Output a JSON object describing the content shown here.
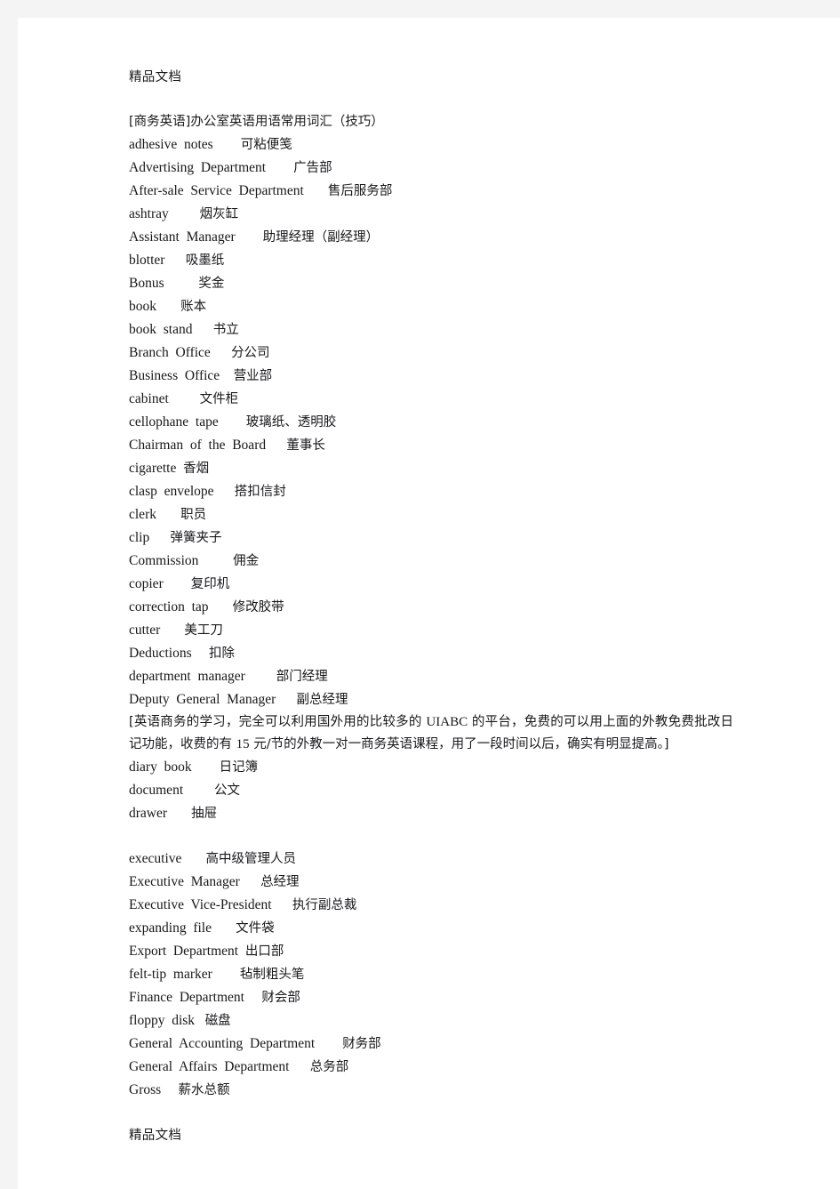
{
  "page": {
    "header_text": "精品文档",
    "footer_text": "精品文档",
    "title": "[商务英语]办公室英语用语常用词汇（技巧）",
    "background_color": "#f4f4f4",
    "paper_color": "#ffffff",
    "text_color": "#18181c"
  },
  "glossary": [
    {
      "en": "adhesive  notes",
      "gap": "        ",
      "cn": "可粘便笺"
    },
    {
      "en": "Advertising  Department",
      "gap": "        ",
      "cn": "广告部"
    },
    {
      "en": "After-sale  Service  Department",
      "gap": "       ",
      "cn": "售后服务部"
    },
    {
      "en": "ashtray",
      "gap": "         ",
      "cn": "烟灰缸"
    },
    {
      "en": "Assistant  Manager",
      "gap": "        ",
      "cn": "助理经理（副经理）"
    },
    {
      "en": "blotter",
      "gap": "      ",
      "cn": "吸墨纸"
    },
    {
      "en": "Bonus",
      "gap": "          ",
      "cn": "奖金"
    },
    {
      "en": "book",
      "gap": "       ",
      "cn": "账本"
    },
    {
      "en": "book  stand",
      "gap": "      ",
      "cn": "书立"
    },
    {
      "en": "Branch  Office",
      "gap": "      ",
      "cn": "分公司"
    },
    {
      "en": "Business  Office",
      "gap": "    ",
      "cn": "营业部"
    },
    {
      "en": "cabinet",
      "gap": "         ",
      "cn": "文件柜"
    },
    {
      "en": "cellophane  tape",
      "gap": "        ",
      "cn": "玻璃纸、透明胶"
    },
    {
      "en": "Chairman  of  the  Board",
      "gap": "      ",
      "cn": "董事长"
    },
    {
      "en": "cigarette",
      "gap": "  ",
      "cn": "香烟"
    },
    {
      "en": "clasp  envelope",
      "gap": "      ",
      "cn": "搭扣信封"
    },
    {
      "en": "clerk",
      "gap": "       ",
      "cn": "职员"
    },
    {
      "en": "clip",
      "gap": "      ",
      "cn": "弹簧夹子"
    },
    {
      "en": "Commission",
      "gap": "          ",
      "cn": "佣金"
    },
    {
      "en": "copier",
      "gap": "        ",
      "cn": "复印机"
    },
    {
      "en": "correction  tap",
      "gap": "       ",
      "cn": "修改胶带"
    },
    {
      "en": "cutter",
      "gap": "       ",
      "cn": "美工刀"
    },
    {
      "en": "Deductions",
      "gap": "     ",
      "cn": "扣除"
    },
    {
      "en": "department  manager",
      "gap": "         ",
      "cn": "部门经理"
    },
    {
      "en": "Deputy  General  Manager",
      "gap": "      ",
      "cn": "副总经理"
    }
  ],
  "note": {
    "prefix": "[英语商务的学习，完全可以利用国外用的比较多的 ",
    "brand": "UIABC",
    "middle": "  的平台，免费的可以用上面的外教免费批改日记功能，收费的有 ",
    "price": "15",
    "suffix": " 元/节的外教一对一商务英语课程，用了一段时间以后，确实有明显提高。]"
  },
  "glossary2": [
    {
      "en": "diary  book",
      "gap": "        ",
      "cn": "日记簿"
    },
    {
      "en": "document",
      "gap": "         ",
      "cn": "公文"
    },
    {
      "en": "drawer",
      "gap": "       ",
      "cn": "抽屉"
    }
  ],
  "glossary3": [
    {
      "en": "executive",
      "gap": "       ",
      "cn": "高中级管理人员"
    },
    {
      "en": "Executive  Manager",
      "gap": "      ",
      "cn": "总经理"
    },
    {
      "en": "Executive  Vice-President",
      "gap": "      ",
      "cn": "执行副总裁"
    },
    {
      "en": "expanding  file",
      "gap": "       ",
      "cn": "文件袋"
    },
    {
      "en": "Export  Department",
      "gap": "  ",
      "cn": "出口部"
    },
    {
      "en": "felt-tip  marker",
      "gap": "        ",
      "cn": "毡制粗头笔"
    },
    {
      "en": "Finance  Department",
      "gap": "     ",
      "cn": "财会部"
    },
    {
      "en": "floppy  disk",
      "gap": "   ",
      "cn": "磁盘"
    },
    {
      "en": "General  Accounting  Department",
      "gap": "        ",
      "cn": "财务部"
    },
    {
      "en": "General  Affairs  Department",
      "gap": "      ",
      "cn": "总务部"
    },
    {
      "en": "Gross",
      "gap": "     ",
      "cn": "薪水总额"
    }
  ]
}
